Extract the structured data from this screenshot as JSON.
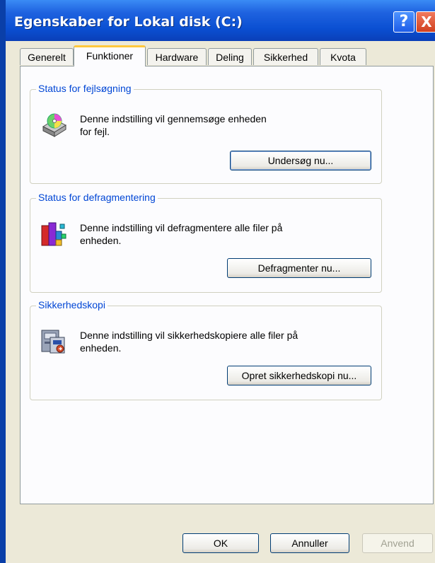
{
  "window": {
    "title": "Egenskaber for Lokal disk (C:)",
    "help_glyph": "?",
    "close_glyph": "X"
  },
  "tabs": [
    {
      "label": "Generelt",
      "active": false
    },
    {
      "label": "Funktioner",
      "active": true
    },
    {
      "label": "Hardware",
      "active": false
    },
    {
      "label": "Deling",
      "active": false
    },
    {
      "label": "Sikkerhed",
      "active": false
    },
    {
      "label": "Kvota",
      "active": false
    }
  ],
  "groups": {
    "errorcheck": {
      "title": "Status for fejlsøgning",
      "line1": "Denne indstilling vil gennemsøge enheden",
      "line2": "for fejl.",
      "button": "Undersøg nu...",
      "icon": "disk-check-icon"
    },
    "defrag": {
      "title": "Status for defragmentering",
      "line1": "Denne indstilling vil defragmentere alle filer på",
      "line2": "enheden.",
      "button": "Defragmenter nu...",
      "icon": "defrag-icon"
    },
    "backup": {
      "title": "Sikkerhedskopi",
      "line1": "Denne indstilling vil sikkerhedskopiere alle filer på",
      "line2": "enheden.",
      "button": "Opret sikkerhedskopi nu...",
      "icon": "backup-icon"
    }
  },
  "footer": {
    "ok": "OK",
    "cancel": "Annuller",
    "apply": "Anvend"
  },
  "colors": {
    "titlebar": "#0a4fd2",
    "group_title": "#0046d5",
    "tab_highlight": "#ffc83c"
  }
}
